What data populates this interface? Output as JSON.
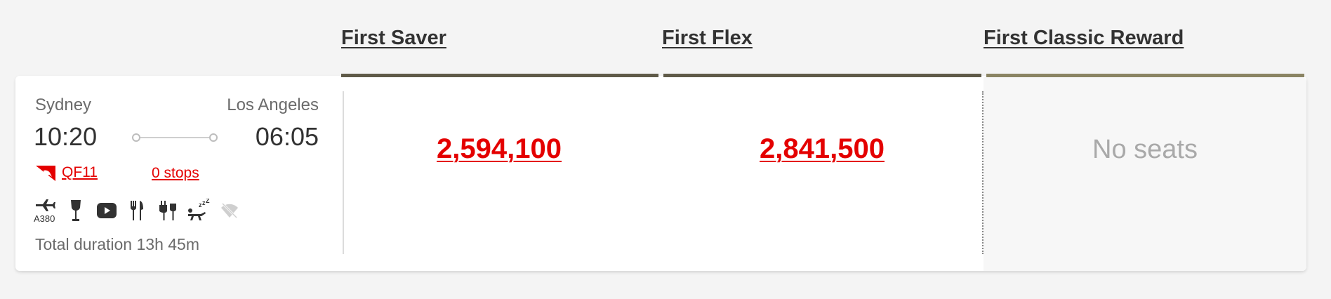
{
  "fare_headers": [
    "First Saver",
    "First Flex",
    "First Classic Reward"
  ],
  "flight": {
    "origin": "Sydney",
    "destination": "Los Angeles",
    "depart_time": "10:20",
    "arrive_time": "06:05",
    "flight_number": "QF11",
    "stops": "0 stops",
    "aircraft": "A380",
    "amenities": [
      "aircraft-icon",
      "wine-glass-icon",
      "entertainment-icon",
      "dining-icon",
      "power-icon",
      "lie-flat-bed-icon",
      "wifi-unavailable-icon"
    ],
    "total_duration": "Total duration 13h 45m"
  },
  "fares": {
    "first_saver": "2,594,100",
    "first_flex": "2,841,500",
    "first_classic_reward": "No seats"
  },
  "colors": {
    "accent_red": "#e40000",
    "fare_bar": "#5f5a48",
    "fare_bar_classic": "#8a8463"
  }
}
